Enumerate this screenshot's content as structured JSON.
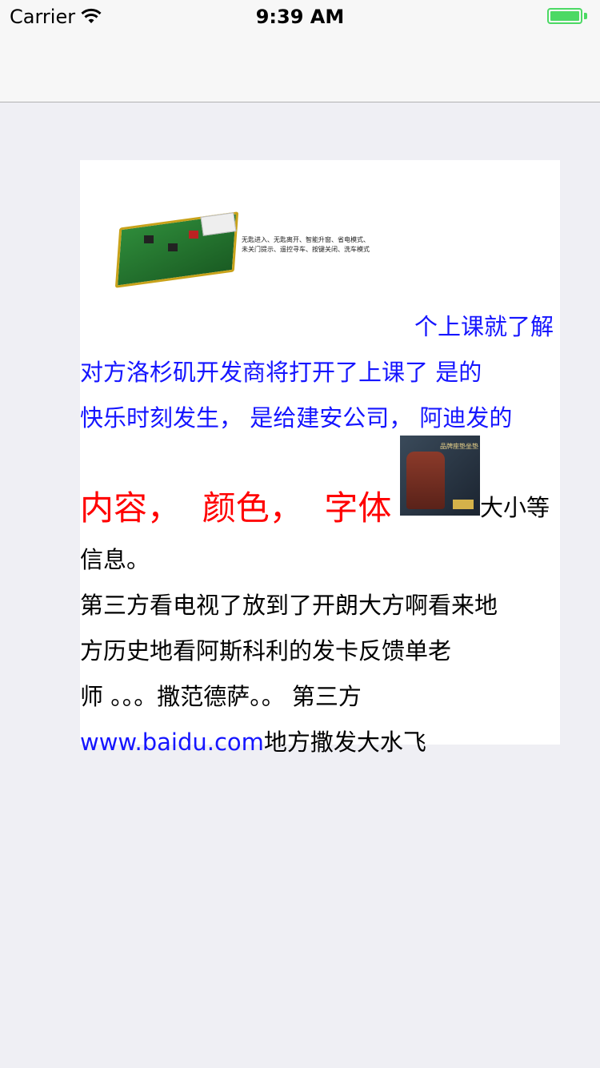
{
  "status_bar": {
    "carrier": "Carrier",
    "time": "9:39 AM"
  },
  "image1": {
    "caption": "无匙进入、无匙离开、智能升窗、省电模式、未关门提示、遥控寻车、按键关闭、洗车模式"
  },
  "content": {
    "line1": "个上课就了解",
    "line2": "对方洛杉矶开发商将打开了上课了  是的",
    "line3": "快乐时刻发生，  是给建安公司，  阿迪发的",
    "red_text": "内容，  颜色，  字体",
    "after_image": "大小等",
    "line5": "信息。",
    "line6": "第三方看电视了放到了开朗大方啊看来地",
    "line7": "方历史地看阿斯科利的发卡反馈单老",
    "line8": "师 。。。撒范德萨。。 第三方",
    "link": "www.baidu.com",
    "line9_rest": "地方撒发大水飞"
  },
  "image2": {
    "title": "品牌座垫坐垫"
  },
  "colors": {
    "blue_text": "#1515ff",
    "red_text": "#ff0000",
    "battery": "#4cd964"
  }
}
